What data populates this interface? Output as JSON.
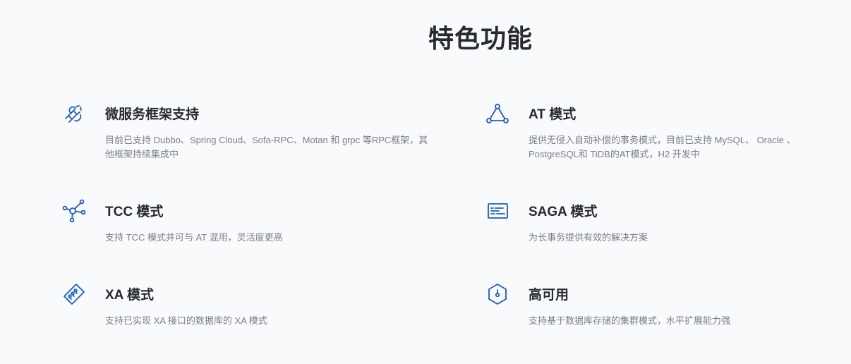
{
  "section": {
    "title": "特色功能"
  },
  "colors": {
    "icon": "#1a5cc8",
    "title": "#262a30",
    "desc": "#7a7f87",
    "background": "#f9fafb"
  },
  "features": [
    {
      "icon": "plug-icon",
      "title": "微服务框架支持",
      "desc": "目前已支持 Dubbo、Spring Cloud、Sofa-RPC、Motan 和 grpc 等RPC框架，其他框架持续集成中"
    },
    {
      "icon": "triangle-nodes-icon",
      "title": "AT 模式",
      "desc": "提供无侵入自动补偿的事务模式，目前已支持 MySQL、 Oracle 、PostgreSQL和 TiDB的AT模式，H2 开发中"
    },
    {
      "icon": "network-nodes-icon",
      "title": "TCC 模式",
      "desc": "支持 TCC 模式并可与 AT 混用，灵活度更高"
    },
    {
      "icon": "window-list-icon",
      "title": "SAGA 模式",
      "desc": "为长事务提供有效的解决方案"
    },
    {
      "icon": "memory-chip-icon",
      "title": "XA 模式",
      "desc": "支持已实现 XA 接口的数据库的 XA 模式"
    },
    {
      "icon": "hexagon-icon",
      "title": "高可用",
      "desc": "支持基于数据库存储的集群模式，水平扩展能力强"
    }
  ]
}
